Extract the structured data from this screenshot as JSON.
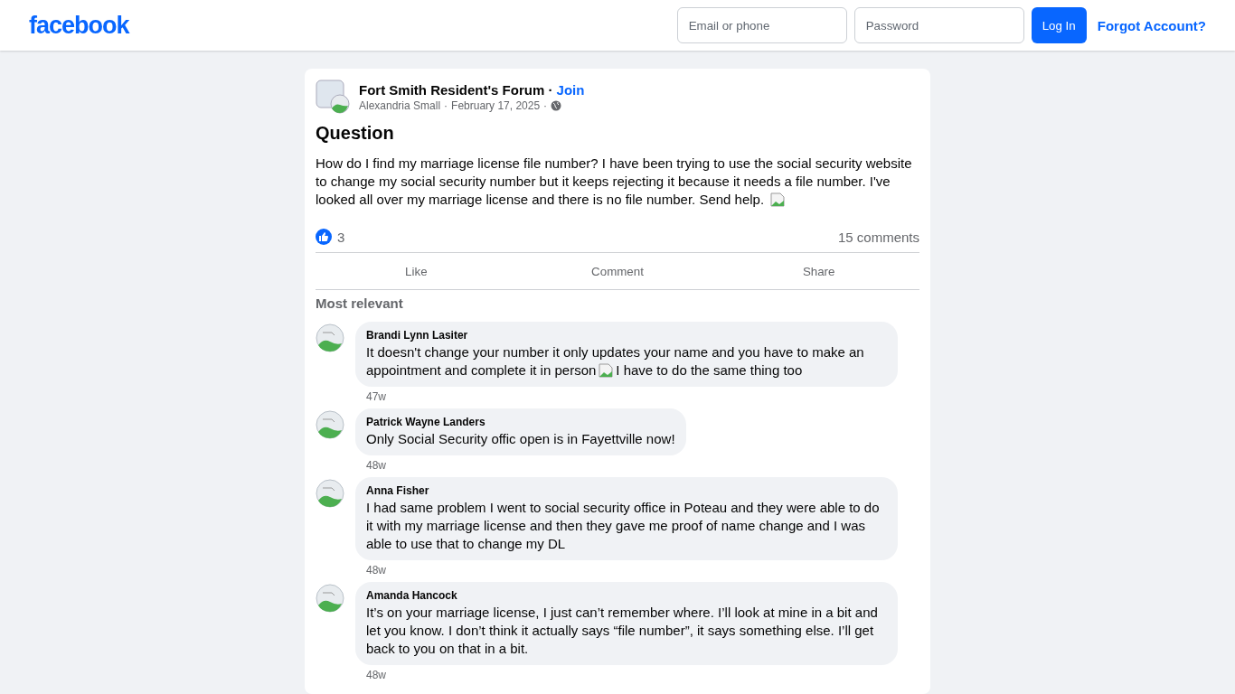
{
  "header": {
    "logo": "facebook",
    "email_placeholder": "Email or phone",
    "password_placeholder": "Password",
    "login_button": "Log In",
    "forgot_link": "Forgot Account?"
  },
  "post": {
    "group": "Fort Smith Resident's Forum",
    "join": "Join",
    "separator": "·",
    "author": "Alexandria Small",
    "date": "February 17, 2025",
    "title": "Question",
    "body": "How do I find my marriage license file number? I have been trying to use the social security website to change my social security number but it keeps rejecting it because it needs a file number. I've looked all over my marriage license and there is no file number. Send help.",
    "reactions": "3",
    "comments_count": "15 comments",
    "actions": [
      "Like",
      "Comment",
      "Share"
    ],
    "sort": "Most relevant"
  },
  "comments": [
    {
      "name": "Brandi Lynn Lasiter",
      "text": "It doesn't change your number it only updates your name and you have to make an appointment and complete it in person",
      "text_after": "I have to do the same thing too",
      "time": "47w"
    },
    {
      "name": "Patrick Wayne Landers",
      "text": "Only Social Security offic open is in Fayettville now!",
      "time": "48w"
    },
    {
      "name": "Anna Fisher",
      "text": "I had same problem I went to social security office in Poteau and they were able to do it with my marriage license and then they gave me proof of name change and I was able to use that to change my DL",
      "time": "48w"
    },
    {
      "name": "Amanda Hancock",
      "text": "It’s on your marriage license, I just can’t remember where. I’ll look at mine in a bit and let you know. I don’t think it actually says “file number”, it says something else. I’ll get back to you on that in a bit.",
      "time": "48w"
    }
  ]
}
